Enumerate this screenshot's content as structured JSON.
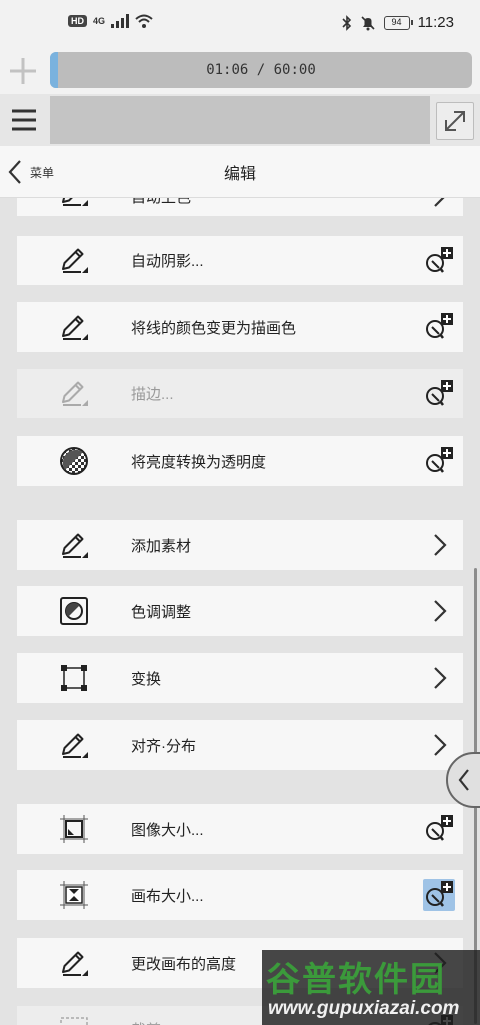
{
  "status_bar": {
    "hd_badge": "HD",
    "network": "4G",
    "battery": "94",
    "time": "11:23"
  },
  "timer": {
    "text": "01:06 / 60:00",
    "progress": 0.018
  },
  "header": {
    "back_label": "菜单",
    "title": "编辑"
  },
  "menu_items": [
    {
      "label": "自动上色",
      "icon": "pen-icon",
      "right": "chevron-right-icon",
      "disabled": false
    },
    {
      "label": "自动阴影...",
      "icon": "pen-icon",
      "right": "add-to-quick-access-icon",
      "disabled": false
    },
    {
      "label": "将线的颜色变更为描画色",
      "icon": "pen-icon",
      "right": "add-to-quick-access-icon",
      "disabled": false
    },
    {
      "label": "描边...",
      "icon": "pen-icon",
      "right": "add-to-quick-access-icon",
      "disabled": true
    },
    {
      "label": "将亮度转换为透明度",
      "icon": "luminance-icon",
      "right": "add-to-quick-access-icon",
      "disabled": false
    },
    {
      "label": "添加素材",
      "icon": "pen-icon",
      "right": "chevron-right-icon",
      "disabled": false
    },
    {
      "label": "色调调整",
      "icon": "color-adjust-icon",
      "right": "chevron-right-icon",
      "disabled": false
    },
    {
      "label": "变换",
      "icon": "transform-icon",
      "right": "chevron-right-icon",
      "disabled": false
    },
    {
      "label": "对齐·分布",
      "icon": "pen-icon",
      "right": "chevron-right-icon",
      "disabled": false
    },
    {
      "label": "图像大小...",
      "icon": "image-size-icon",
      "right": "add-to-quick-access-icon",
      "disabled": false
    },
    {
      "label": "画布大小...",
      "icon": "canvas-size-icon",
      "right": "add-to-quick-access-icon",
      "disabled": false,
      "highlight": true
    },
    {
      "label": "更改画布的高度",
      "icon": "pen-icon",
      "right": "chevron-right-icon",
      "disabled": false
    },
    {
      "label": "裁剪",
      "icon": "crop-icon",
      "right": "add-to-quick-access-icon",
      "disabled": true
    }
  ],
  "watermark": {
    "title": "谷普软件园",
    "url": "www.gupuxiazai.com"
  },
  "colors": {
    "accent_fill": "#7ab2de",
    "highlight": "#9fc3e6",
    "watermark_green": "#3b9a3b"
  }
}
